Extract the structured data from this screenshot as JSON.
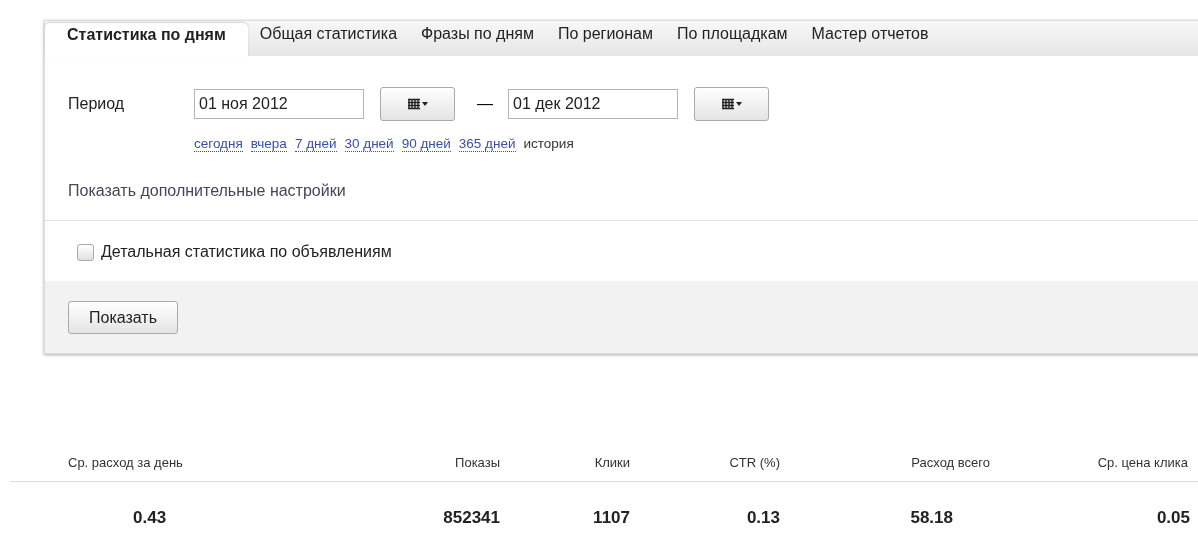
{
  "tabs": [
    {
      "label": "Статистика по дням",
      "selected": true
    },
    {
      "label": "Общая статистика",
      "selected": false
    },
    {
      "label": "Фразы по дням",
      "selected": false
    },
    {
      "label": "По регионам",
      "selected": false
    },
    {
      "label": "По площадкам",
      "selected": false
    },
    {
      "label": "Мастер отчетов",
      "selected": false
    }
  ],
  "period": {
    "label": "Период",
    "from": "01 ноя 2012",
    "separator": "—",
    "to": "01 дек 2012"
  },
  "quick_ranges": [
    {
      "label": "сегодня",
      "kind": "link"
    },
    {
      "label": "вчера",
      "kind": "link"
    },
    {
      "label": "7 дней",
      "kind": "link"
    },
    {
      "label": "30 дней",
      "kind": "link"
    },
    {
      "label": "90 дней",
      "kind": "link"
    },
    {
      "label": "365 дней",
      "kind": "link"
    },
    {
      "label": "история",
      "kind": "text"
    }
  ],
  "more_settings": "Показать дополнительные настройки",
  "detail_option": {
    "label": "Детальная статистика по объявлениям",
    "checked": false
  },
  "show_button": "Показать",
  "table": {
    "columns": [
      "Ср. расход за день",
      "Показы",
      "Клики",
      "CTR (%)",
      "Расход всего",
      "Ср. цена клика"
    ],
    "rows": [
      [
        "0.43",
        "852341",
        "1107",
        "0.13",
        "58.18",
        "0.05"
      ]
    ]
  }
}
